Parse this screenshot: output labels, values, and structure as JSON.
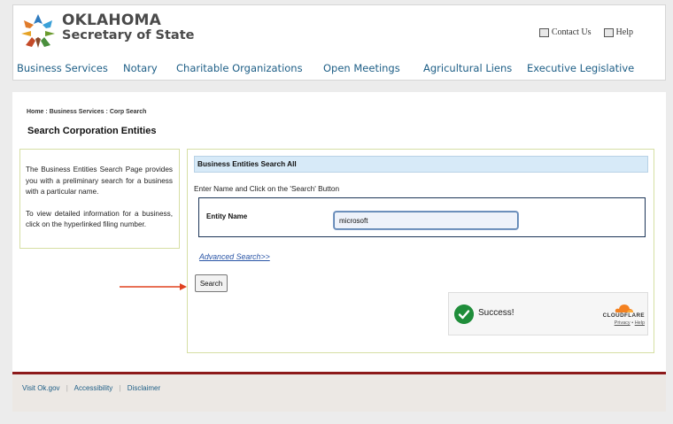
{
  "header": {
    "brand_line1": "OKLAHOMA",
    "brand_line2": "Secretary of State",
    "top_links": [
      {
        "label": "Contact Us",
        "icon": "contact-icon"
      },
      {
        "label": "Help",
        "icon": "help-icon"
      }
    ],
    "nav": [
      "Business Services",
      "Notary",
      "Charitable Organizations",
      "Open Meetings",
      "Agricultural Liens",
      "Executive Legislative"
    ]
  },
  "breadcrumb": {
    "home": "Home",
    "business_services": "Business Services",
    "current": "Corp Search",
    "separator": ":"
  },
  "page_title": "Search Corporation Entities",
  "info": {
    "para1": "The Business Entities Search Page provides you with a preliminary search for a business with a particular name.",
    "para2": "To view detailed information for a business, click on the hyperlinked filing number."
  },
  "search": {
    "heading": "Business Entities Search All",
    "instructions": "Enter Name and Click on the 'Search' Button",
    "entity_label": "Entity Name",
    "entity_value": "microsoft",
    "advanced_link": "Advanced Search>>",
    "button_label": "Search"
  },
  "captcha": {
    "status": "Success!",
    "provider": "CLOUDFLARE",
    "privacy": "Privacy",
    "help": "Help",
    "dot": "•"
  },
  "footer": {
    "links": [
      "Visit Ok.gov",
      "Accessibility",
      "Disclaimer"
    ],
    "separator": "|"
  },
  "colors": {
    "nav_link": "#1d5e86",
    "footer_rule": "#8d1a1a",
    "success_green": "#1f8d3a",
    "arrow": "#e0421f",
    "cloudflare_orange": "#f48120"
  }
}
